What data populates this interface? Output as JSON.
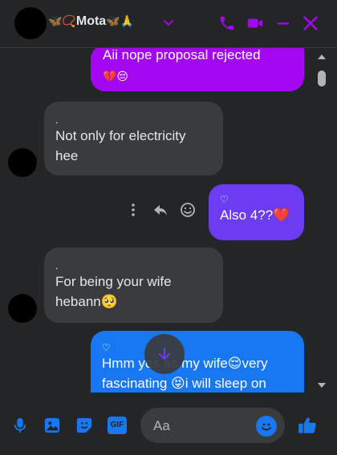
{
  "header": {
    "title": "Mota",
    "title_prefix_emoji": "🦋📿",
    "title_suffix_emoji": "🦋🙏",
    "accent": "#a306f0"
  },
  "messages": [
    {
      "id": "m1",
      "direction": "outgoing",
      "line1": "Aii nope proposal rejected",
      "line2": "💔😔",
      "color": "#a306f0"
    },
    {
      "id": "m2",
      "direction": "incoming",
      "marker": ".",
      "lines": [
        "Not only for electricity",
        "hee"
      ]
    },
    {
      "id": "m3",
      "direction": "outgoing",
      "marker": "♡",
      "lines": [
        "Also 4??❤️"
      ],
      "color": "#6b3cf0"
    },
    {
      "id": "m4",
      "direction": "incoming",
      "marker": ".",
      "lines": [
        "For being your wife",
        "hebann🥺"
      ]
    },
    {
      "id": "m5",
      "direction": "outgoing",
      "marker": "♡",
      "lines": [
        "Hmm yes as my wife😌very",
        "fascinating 😝i will sleep on"
      ],
      "color": "#1877f2"
    }
  ],
  "composer": {
    "placeholder": "Aa",
    "gif_label": "GIF"
  },
  "icons": {
    "phone": "phone-icon",
    "video": "video-icon",
    "minimize": "minimize-icon",
    "close": "close-icon",
    "mic": "mic-icon",
    "image": "image-icon",
    "sticker": "sticker-icon",
    "gif": "gif-icon",
    "like": "thumbs-up-icon"
  }
}
